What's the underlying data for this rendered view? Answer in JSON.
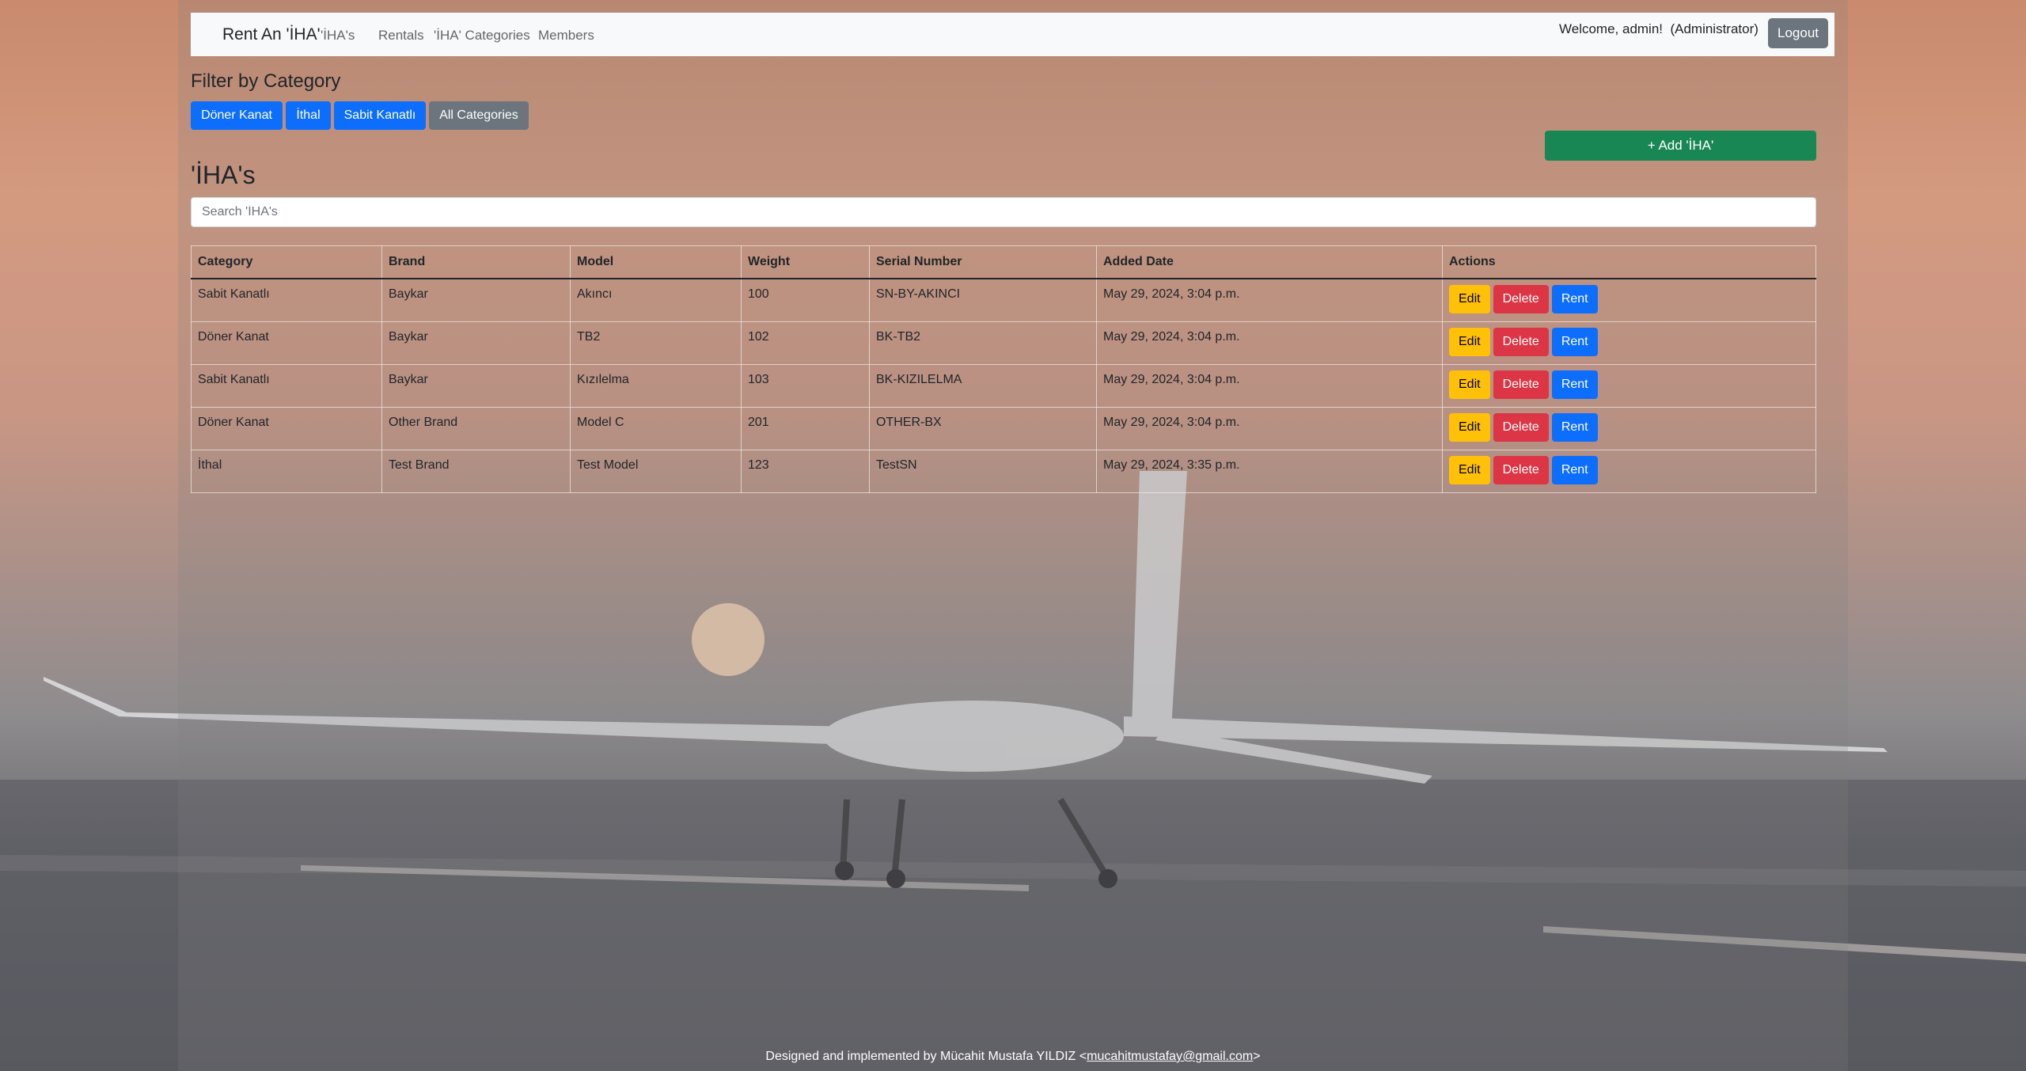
{
  "navbar": {
    "brand": "Rent An 'İHA'",
    "links": [
      "'İHA's",
      "Rentals",
      "'İHA' Categories",
      "Members"
    ],
    "welcome": "Welcome, admin!  (Administrator)",
    "logout": "Logout"
  },
  "filter": {
    "title": "Filter by Category",
    "buttons": [
      "Döner Kanat",
      "İthal",
      "Sabit Kanatlı",
      "All Categories"
    ]
  },
  "add_button": "+ Add 'İHA'",
  "page_title": "'İHA's",
  "search_placeholder": "Search 'İHA's",
  "table": {
    "headers": [
      "Category",
      "Brand",
      "Model",
      "Weight",
      "Serial Number",
      "Added Date",
      "Actions"
    ],
    "rows": [
      [
        "Sabit Kanatlı",
        "Baykar",
        "Akıncı",
        "100",
        "SN-BY-AKINCI",
        "May 29, 2024, 3:04 p.m."
      ],
      [
        "Döner Kanat",
        "Baykar",
        "TB2",
        "102",
        "BK-TB2",
        "May 29, 2024, 3:04 p.m."
      ],
      [
        "Sabit Kanatlı",
        "Baykar",
        "Kızılelma",
        "103",
        "BK-KIZILELMA",
        "May 29, 2024, 3:04 p.m."
      ],
      [
        "Döner Kanat",
        "Other Brand",
        "Model C",
        "201",
        "OTHER-BX",
        "May 29, 2024, 3:04 p.m."
      ],
      [
        "İthal",
        "Test Brand",
        "Test Model",
        "123",
        "TestSN",
        "May 29, 2024, 3:35 p.m."
      ]
    ],
    "actions": [
      "Edit",
      "Delete",
      "Rent"
    ]
  },
  "footer": {
    "text": "Designed and implemented by Mücahit Mustafa YILDIZ <",
    "email": "mucahitmustafay@gmail.com",
    "suffix": ">"
  },
  "colors": {
    "primary": "#0d6efd",
    "secondary": "#6c757d",
    "success": "#198754",
    "warning": "#ffc107",
    "danger": "#dc3545"
  }
}
